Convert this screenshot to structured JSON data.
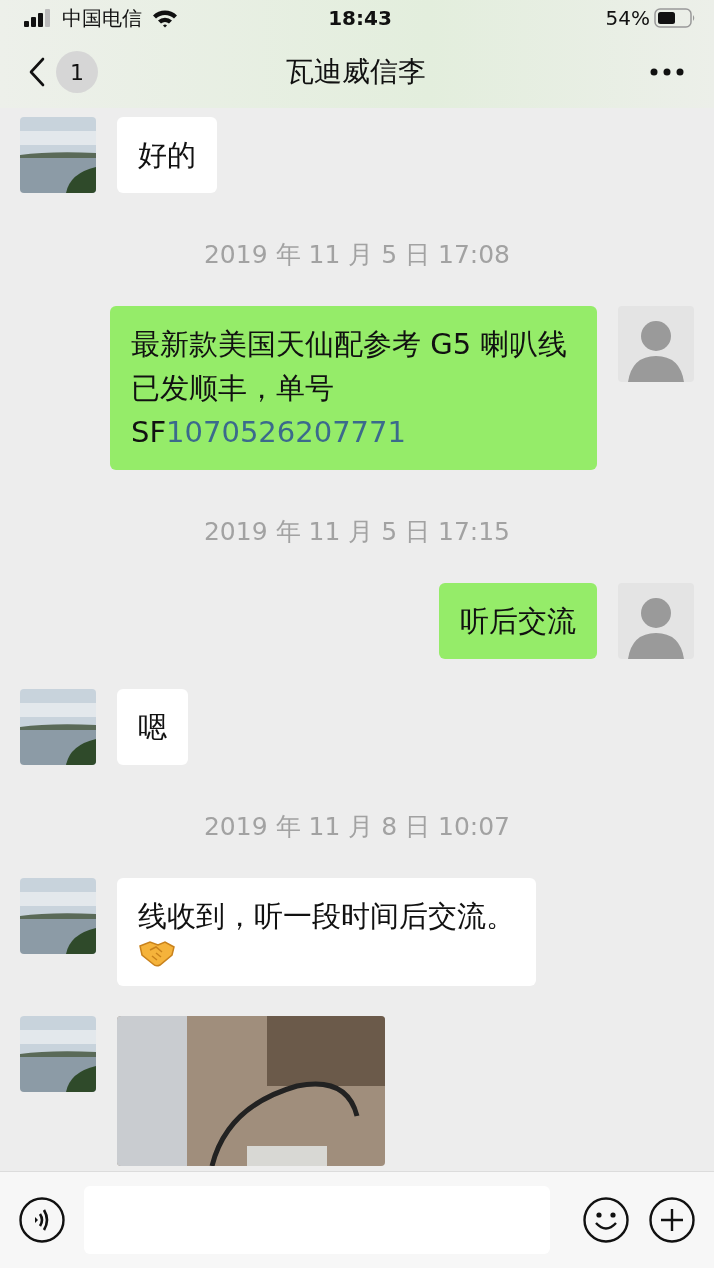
{
  "status_bar": {
    "carrier": "中国电信",
    "time": "18:43",
    "battery": "54%"
  },
  "nav": {
    "unread": "1",
    "title": "瓦迪威信李"
  },
  "messages": [
    {
      "kind": "incoming",
      "text": "好的"
    },
    {
      "kind": "time",
      "text": "2019 年 11 月 5 日 17:08"
    },
    {
      "kind": "outgoing",
      "text": "最新款美国天仙配参考 G5 喇叭线已发顺丰，单号 SF",
      "link": "1070526207771"
    },
    {
      "kind": "time",
      "text": "2019 年 11 月 5 日 17:15"
    },
    {
      "kind": "outgoing",
      "text": "听后交流"
    },
    {
      "kind": "incoming",
      "text": "嗯"
    },
    {
      "kind": "time",
      "text": "2019 年 11 月 8 日 10:07"
    },
    {
      "kind": "incoming",
      "text": "线收到，听一段时间后交流。",
      "handshake_emoji": true
    },
    {
      "kind": "incoming_image"
    }
  ]
}
